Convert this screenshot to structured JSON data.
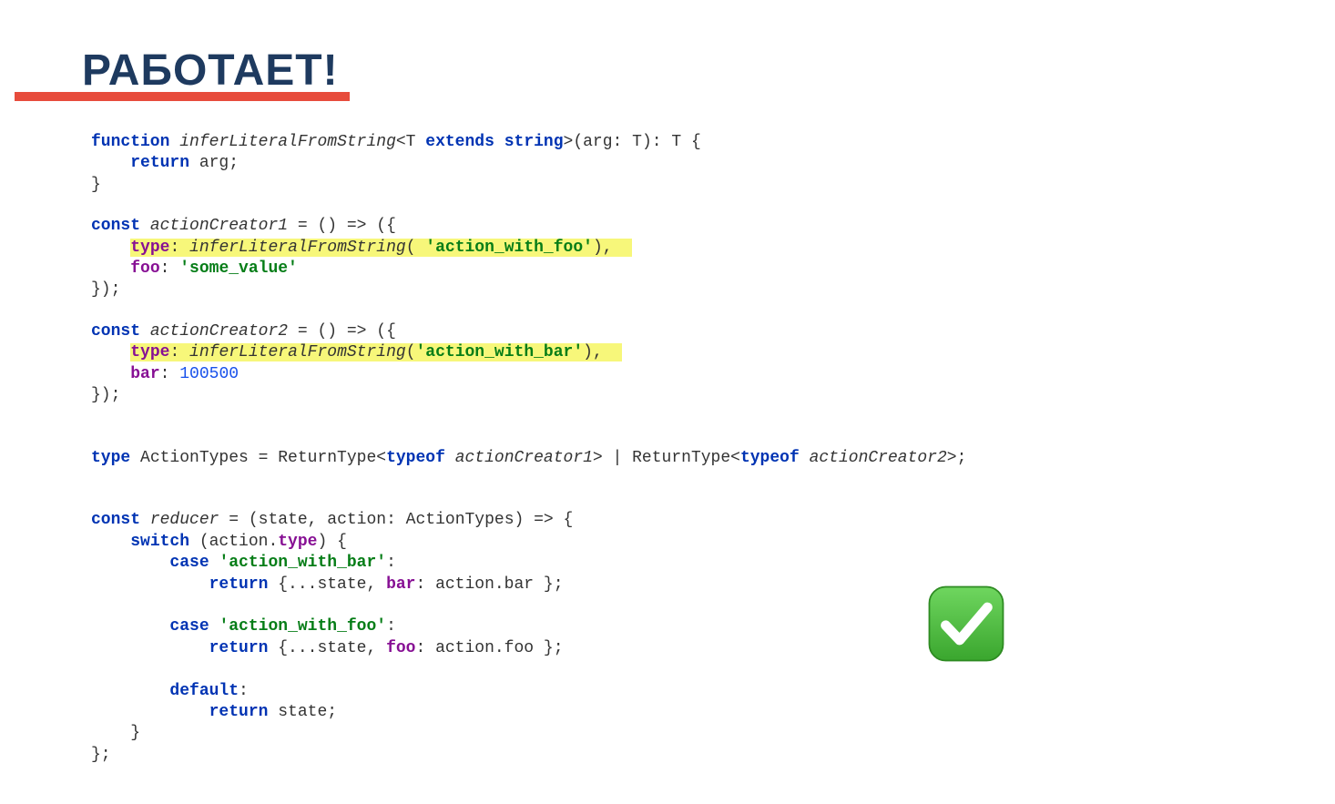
{
  "title": "РАБОТАЕТ!",
  "code": {
    "fn_kw": "function",
    "fn_name": "inferLiteralFromString",
    "fn_generic_open": "<T ",
    "extends_kw": "extends",
    "string_kw": "string",
    "fn_generic_close": ">(arg: T): T {",
    "return_kw": "return",
    "return_arg": " arg;",
    "brace_close": "}",
    "const_kw": "const",
    "ac1_name": "actionCreator1",
    "arrow_open": " = () => ({",
    "type_prop": "type",
    "ac1_type_call_pre": ": ",
    "ac1_type_fn": "inferLiteralFromString",
    "ac1_type_args_open": "( ",
    "ac1_type_str": "'action_with_foo'",
    "ac1_type_args_close": "),",
    "foo_prop": "foo",
    "foo_sep": ": ",
    "foo_val": "'some_value'",
    "obj_close": "});",
    "ac2_name": "actionCreator2",
    "ac2_type_args_open": "(",
    "ac2_type_str": "'action_with_bar'",
    "ac2_type_args_close": "),",
    "bar_prop": "bar",
    "bar_sep": ": ",
    "bar_val": "100500",
    "type_kw": "type",
    "at_name": " ActionTypes = ReturnType<",
    "typeof_kw": "typeof",
    "at_ac1": " actionCreator1",
    "at_mid": "> | ReturnType<",
    "at_ac2": " actionCreator2",
    "at_end": ">;",
    "reducer_name": "reducer",
    "reducer_sig": " = (state, action: ActionTypes) => {",
    "switch_kw": "switch",
    "switch_expr_open": " (action.",
    "switch_type_prop": "type",
    "switch_expr_close": ") {",
    "case_kw": "case",
    "case1_str": "'action_with_bar'",
    "colon": ":",
    "ret1_pre": " {...state, ",
    "ret1_prop": "bar",
    "ret1_post": ": action.bar };",
    "case2_str": "'action_with_foo'",
    "ret2_pre": " {...state, ",
    "ret2_prop": "foo",
    "ret2_post": ": action.foo };",
    "default_kw": "default",
    "ret3": " state;",
    "reducer_close": "};"
  },
  "icon": "checkmark"
}
